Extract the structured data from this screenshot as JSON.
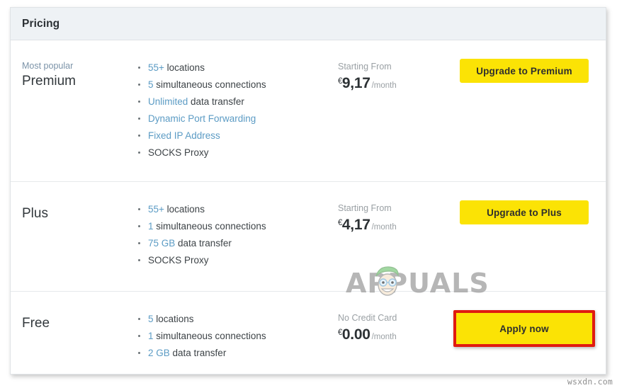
{
  "card": {
    "header_title": "Pricing"
  },
  "plans": [
    {
      "badge": "Most popular",
      "name": "Premium",
      "features": [
        {
          "highlight": "55+",
          "rest": " locations"
        },
        {
          "highlight": "5",
          "rest": " simultaneous connections"
        },
        {
          "highlight": "Unlimited",
          "rest": " data transfer"
        },
        {
          "highlight": "Dynamic Port Forwarding",
          "rest": ""
        },
        {
          "highlight": "Fixed IP Address",
          "rest": ""
        },
        {
          "highlight": "",
          "rest": "SOCKS Proxy"
        }
      ],
      "price_caption": "Starting From",
      "currency": "€",
      "amount": "9,17",
      "period": "/month",
      "cta_label": "Upgrade to Premium",
      "cta_annotated": false
    },
    {
      "badge": "",
      "name": "Plus",
      "features": [
        {
          "highlight": "55+",
          "rest": " locations"
        },
        {
          "highlight": "1",
          "rest": " simultaneous connections"
        },
        {
          "highlight": "75 GB",
          "rest": " data transfer"
        },
        {
          "highlight": "",
          "rest": "SOCKS Proxy"
        }
      ],
      "price_caption": "Starting From",
      "currency": "€",
      "amount": "4,17",
      "period": "/month",
      "cta_label": "Upgrade to Plus",
      "cta_annotated": false
    },
    {
      "badge": "",
      "name": "Free",
      "features": [
        {
          "highlight": "5",
          "rest": " locations"
        },
        {
          "highlight": "1",
          "rest": " simultaneous connections"
        },
        {
          "highlight": "2 GB",
          "rest": " data transfer"
        }
      ],
      "price_caption": "No Credit Card",
      "currency": "€",
      "amount": "0.00",
      "period": "/month",
      "cta_label": "Apply now",
      "cta_annotated": true
    }
  ],
  "watermarks": {
    "brand": "APPUALS",
    "corner": "wsxdn.com"
  },
  "colors": {
    "cta_yellow": "#fbe305",
    "annotation_red": "#e01b10",
    "feature_highlight": "#5b9bc4",
    "header_bg": "#eef2f5"
  }
}
